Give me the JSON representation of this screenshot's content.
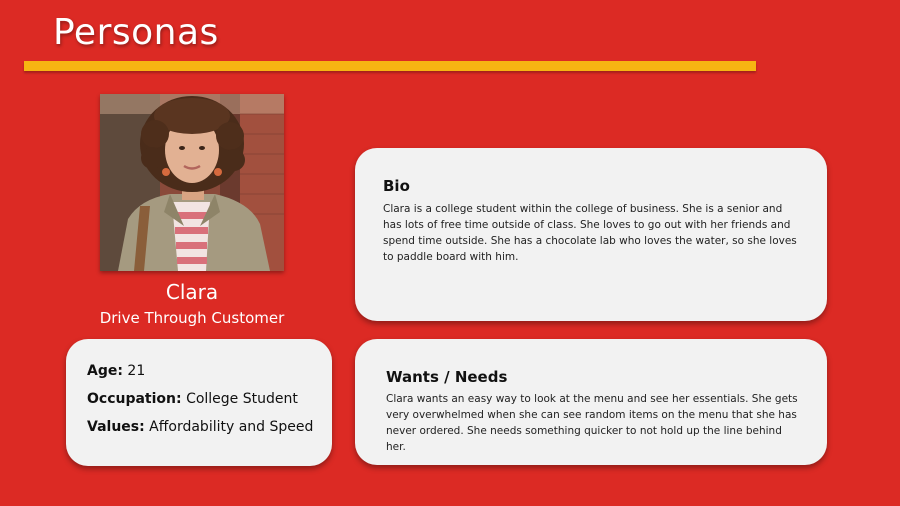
{
  "slide": {
    "title": "Personas",
    "accent_color": "#f7b512",
    "background_color": "#dc2a24"
  },
  "persona": {
    "photo_icon": "persona-photo",
    "name": "Clara",
    "role": "Drive Through Customer"
  },
  "info": {
    "age_label": "Age:",
    "age_value": "21",
    "occupation_label": "Occupation:",
    "occupation_value": "College Student",
    "values_label": "Values:",
    "values_value": "Affordability and Speed"
  },
  "bio": {
    "heading": "Bio",
    "text": "Clara is a college student within the college of business. She is a senior and has lots of free time outside of class. She loves to go out with her friends and spend time outside. She has a chocolate lab who loves the water, so she loves to paddle board with him."
  },
  "wants": {
    "heading": "Wants / Needs",
    "text": "Clara wants an easy way to look at the menu and see her essentials. She gets very overwhelmed when she can see random items on the menu that she has never ordered. She needs something quicker to not hold up the line behind her."
  }
}
